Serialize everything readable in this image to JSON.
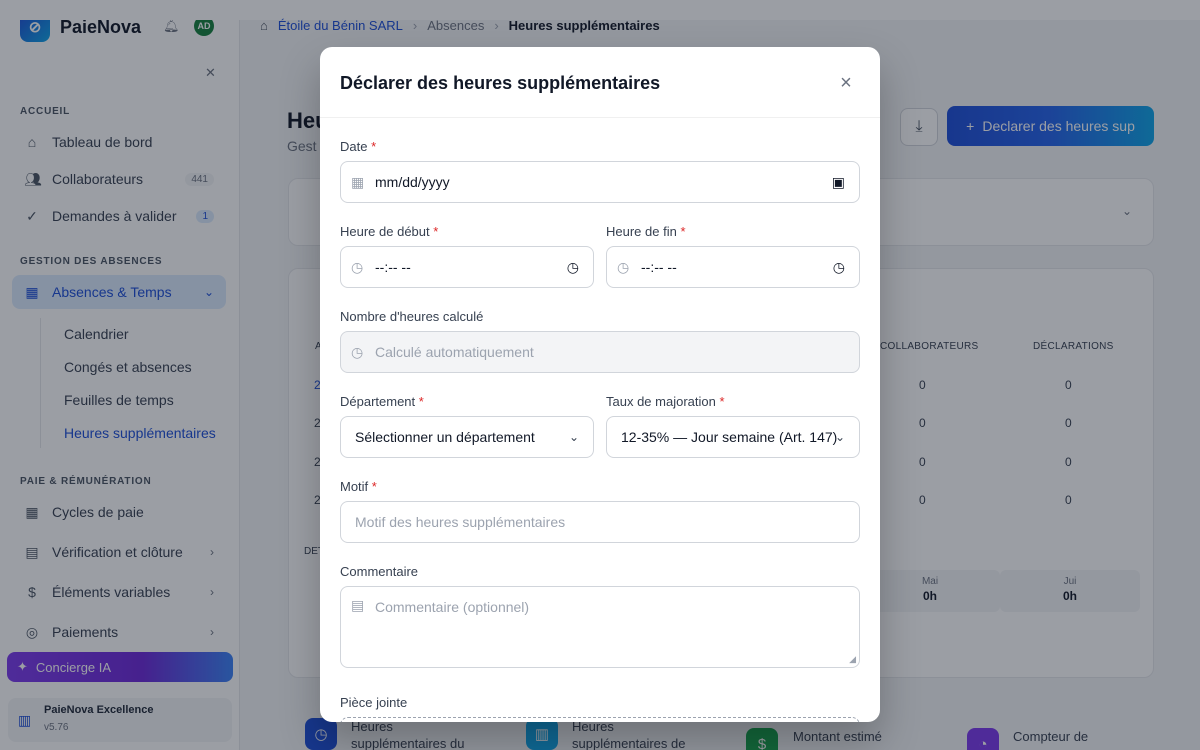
{
  "app": {
    "name": "PaieNova",
    "user_initials": "AD"
  },
  "breadcrumb": {
    "company": "Étoile du Bénin SARL",
    "section": "Absences",
    "current": "Heures supplémentaires"
  },
  "sidebar": {
    "section_accueil": "ACCUEIL",
    "dashboard": "Tableau de bord",
    "collaborators": "Collaborateurs",
    "collaborators_count": "441",
    "requests": "Demandes à valider",
    "requests_count": "1",
    "section_absences": "GESTION DES ABSENCES",
    "absences_time": "Absences & Temps",
    "sub_calendar": "Calendrier",
    "sub_leave": "Congés et absences",
    "sub_timesheets": "Feuilles de temps",
    "sub_overtime": "Heures supplémentaires",
    "section_payroll": "PAIE & RÉMUNÉRATION",
    "pay_cycles": "Cycles de paie",
    "verification": "Vérification et clôture",
    "variables": "Éléments variables",
    "payments": "Paiements",
    "concierge": "Concierge IA",
    "excellence_title": "PaieNova Excellence",
    "excellence_version": "v5.76"
  },
  "page": {
    "title_partial": "Heu",
    "subtitle_partial": "Gest",
    "declare_button": "Declarer des heures sup",
    "table_col_a": "A",
    "table_col_collaborators": "COLLABORATEURS",
    "table_col_declarations": "DÉCLARATIONS",
    "row_prefix": "2",
    "cell_zero": "0",
    "detail_partial": "DET",
    "month_may": "Mai",
    "month_jun": "Jui",
    "hours_zero": "0h",
    "stat1": "Heures supplémentaires du",
    "stat2": "Heures supplémentaires de",
    "stat3": "Montant estimé",
    "stat4": "Compteur de"
  },
  "modal": {
    "title": "Déclarer des heures supplémentaires",
    "date_label": "Date",
    "date_placeholder": "mm/dd/yyyy",
    "start_label": "Heure de début",
    "end_label": "Heure de fin",
    "time_placeholder": "--:-- --",
    "hours_label": "Nombre d'heures calculé",
    "hours_placeholder": "Calculé automatiquement",
    "department_label": "Département",
    "department_value": "Sélectionner un département",
    "rate_label": "Taux de majoration",
    "rate_value": "12-35% — Jour semaine (Art. 147)",
    "reason_label": "Motif",
    "reason_placeholder": "Motif des heures supplémentaires",
    "comment_label": "Commentaire",
    "comment_placeholder": "Commentaire (optionnel)",
    "attachment_label": "Pièce jointe",
    "required_mark": "*"
  },
  "colors": {
    "primary": "#1d4ed8",
    "required": "#dc2626",
    "overlay": "rgba(17,24,39,0.42)"
  }
}
